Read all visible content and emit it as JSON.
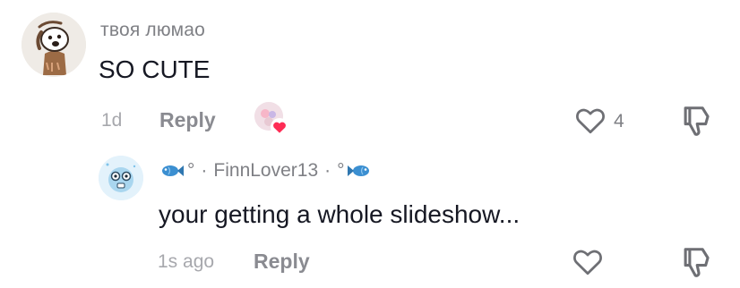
{
  "comment": {
    "username": "твоя люмао",
    "text": "SO CUTE",
    "time": "1d",
    "reply_label": "Reply",
    "like_count": "4",
    "avatar_icon": "cartoon-dog-avatar",
    "liker_avatar_icon": "liked-by-creator-avatar"
  },
  "reply": {
    "username_prefix": "°",
    "username_sep1": "·",
    "username": "FinnLover13",
    "username_sep2": "·",
    "username_suffix": "°",
    "text": "your getting a whole slideshow...",
    "time": "1s ago",
    "reply_label": "Reply",
    "avatar_icon": "cartoon-creature-avatar"
  },
  "colors": {
    "text": "#161823",
    "muted": "#7f8085",
    "heart_badge": "#fe2c55",
    "fish": "#3b8fd1"
  }
}
